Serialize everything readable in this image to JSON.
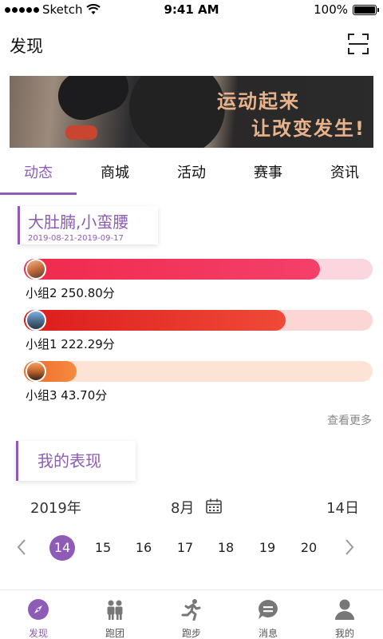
{
  "status_bar": {
    "carrier": "Sketch",
    "time": "9:41 AM",
    "battery": "100%"
  },
  "nav": {
    "title": "发现",
    "scan_icon": "scan-icon"
  },
  "banner": {
    "line1": "运动起来",
    "line2": "让改变发生!"
  },
  "tabs": [
    {
      "label": "动态",
      "active": true
    },
    {
      "label": "商城"
    },
    {
      "label": "活动"
    },
    {
      "label": "赛事"
    },
    {
      "label": "资讯"
    }
  ],
  "challenge": {
    "title": "大肚腩,小蛮腰",
    "date_range": "2019-08-21-2019-09-17",
    "rankings": [
      {
        "label": "小组2  250.80分",
        "progress": 0.85,
        "color_start": "#f02a4c",
        "color_end": "#f4406a",
        "track": "#fcd6df"
      },
      {
        "label": "小组1  222.29分",
        "progress": 0.75,
        "color_start": "#dc1c1c",
        "color_end": "#f04a38",
        "track": "#fcd6d4"
      },
      {
        "label": "小组3  43.70分",
        "progress": 0.15,
        "color_start": "#ee6a2a",
        "color_end": "#f58a40",
        "track": "#fde3d6"
      }
    ],
    "see_more": "查看更多"
  },
  "performance": {
    "title": "我的表现",
    "year": "2019年",
    "month": "8月",
    "day": "14日",
    "week": [
      "14",
      "15",
      "16",
      "17",
      "18",
      "19",
      "20"
    ],
    "selected": "14"
  },
  "tabbar": [
    {
      "label": "发现",
      "icon": "compass-icon",
      "active": true
    },
    {
      "label": "跑团",
      "icon": "group-icon"
    },
    {
      "label": "跑步",
      "icon": "runner-icon"
    },
    {
      "label": "消息",
      "icon": "message-icon"
    },
    {
      "label": "我的",
      "icon": "user-icon"
    }
  ],
  "colors": {
    "accent": "#8e5bb7"
  }
}
